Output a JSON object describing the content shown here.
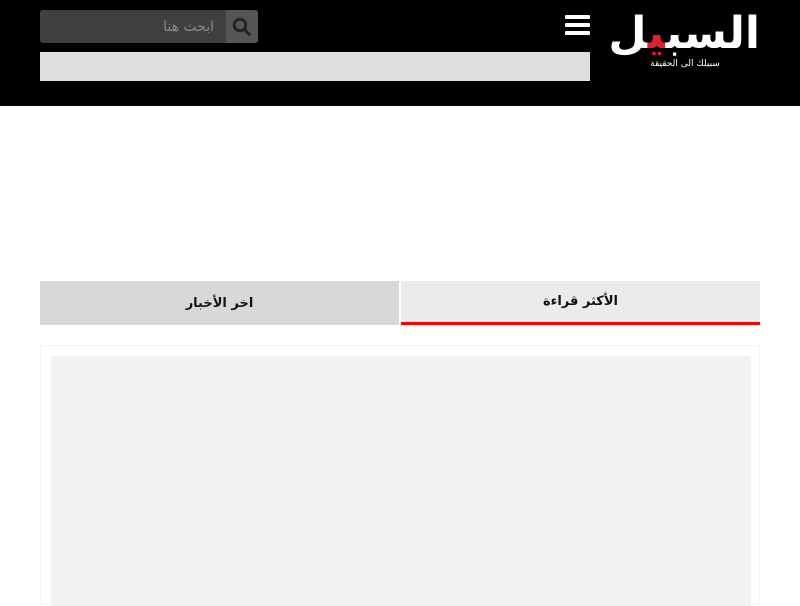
{
  "header": {
    "logo": {
      "text_start": "السب",
      "text_red": "ي",
      "text_end": "ل",
      "tagline": "سبيلك الى الحقيقة",
      "accent_color": "#e0202b"
    },
    "menu_icon": "hamburger-icon",
    "search": {
      "placeholder": "ابحث هنا",
      "icon": "search-icon"
    }
  },
  "tabs": [
    {
      "label": "الأكثر قراءة",
      "active": true
    },
    {
      "label": "اخر الأخبار",
      "active": false
    }
  ],
  "colors": {
    "active_tab_underline": "#ff0000",
    "header_bg": "#000000"
  }
}
